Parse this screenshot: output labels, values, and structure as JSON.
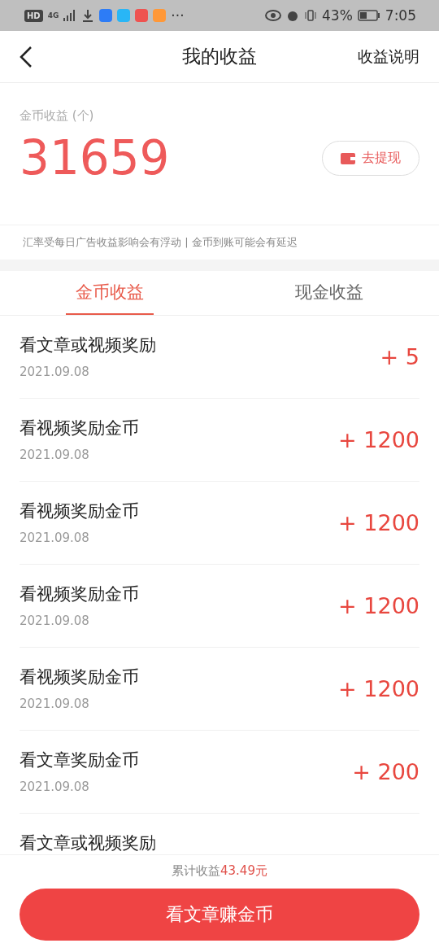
{
  "status_bar": {
    "hd": "HD",
    "network": "4G",
    "more": "···",
    "battery": "43%",
    "time": "7:05"
  },
  "header": {
    "title": "我的收益",
    "action": "收益说明"
  },
  "summary": {
    "label": "金币收益 (个)",
    "amount": "31659",
    "withdraw": "去提现"
  },
  "note": "汇率受每日广告收益影响会有浮动 | 金币到账可能会有延迟",
  "tabs": [
    {
      "label": "金币收益",
      "selected": true
    },
    {
      "label": "现金收益",
      "selected": false
    }
  ],
  "records": [
    {
      "title": "看文章或视频奖励",
      "date": "2021.09.08",
      "amount": "+ 5"
    },
    {
      "title": "看视频奖励金币",
      "date": "2021.09.08",
      "amount": "+ 1200"
    },
    {
      "title": "看视频奖励金币",
      "date": "2021.09.08",
      "amount": "+ 1200"
    },
    {
      "title": "看视频奖励金币",
      "date": "2021.09.08",
      "amount": "+ 1200"
    },
    {
      "title": "看视频奖励金币",
      "date": "2021.09.08",
      "amount": "+ 1200"
    },
    {
      "title": "看文章奖励金币",
      "date": "2021.09.08",
      "amount": "+ 200"
    },
    {
      "title": "看文章或视频奖励"
    }
  ],
  "footer": {
    "total": "累计收益**43.49元**",
    "button": "看文章赚金币"
  }
}
